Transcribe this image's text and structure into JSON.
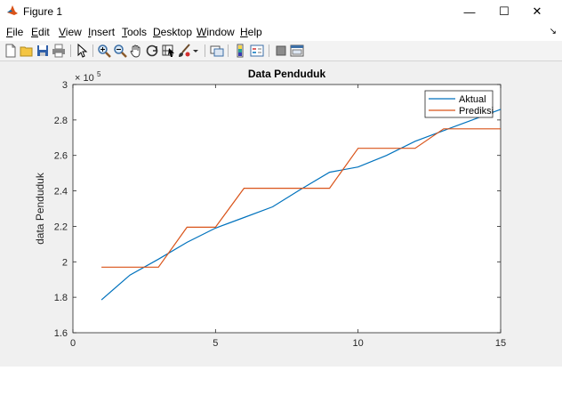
{
  "window": {
    "title": "Figure 1",
    "minimize_glyph": "—",
    "maximize_glyph": "☐",
    "close_glyph": "✕",
    "dock_glyph": "↘"
  },
  "menu": [
    {
      "label": "File",
      "u": "F",
      "rest": "ile"
    },
    {
      "label": "Edit",
      "u": "E",
      "rest": "dit"
    },
    {
      "label": "View",
      "u": "V",
      "rest": "iew"
    },
    {
      "label": "Insert",
      "u": "I",
      "rest": "nsert"
    },
    {
      "label": "Tools",
      "u": "T",
      "rest": "ools"
    },
    {
      "label": "Desktop",
      "u": "D",
      "rest": "esktop"
    },
    {
      "label": "Window",
      "u": "W",
      "rest": "indow"
    },
    {
      "label": "Help",
      "u": "H",
      "rest": "elp"
    }
  ],
  "toolbar": {
    "icons": [
      "new-figure-icon",
      "open-file-icon",
      "save-icon",
      "print-icon",
      "edit-plot-arrow-icon",
      "zoom-in-icon",
      "zoom-out-icon",
      "pan-hand-icon",
      "rotate-3d-icon",
      "data-cursor-icon",
      "brush-icon",
      "brush-dropdown-icon",
      "link-plot-icon",
      "colorbar-icon",
      "legend-icon",
      "hide-plot-tools-icon",
      "show-plot-tools-icon"
    ]
  },
  "chart_data": {
    "type": "line",
    "title": "Data Penduduk",
    "xlabel": "",
    "ylabel": "data Penduduk",
    "xlim": [
      0,
      15
    ],
    "ylim": [
      1.6,
      3.0
    ],
    "y_exponent_label": "× 10",
    "y_exponent_power": "5",
    "xticks": [
      "0",
      "5",
      "10",
      "15"
    ],
    "xtick_values": [
      0,
      5,
      10,
      15
    ],
    "yticks": [
      "1.6",
      "1.8",
      "2",
      "2.2",
      "2.4",
      "2.6",
      "2.8",
      "3"
    ],
    "ytick_values": [
      1.6,
      1.8,
      2.0,
      2.2,
      2.4,
      2.6,
      2.8,
      3.0
    ],
    "legend_position": "top-right",
    "grid": false,
    "series": [
      {
        "name": "Aktual",
        "color": "#0072bd",
        "x": [
          1,
          2,
          3,
          4,
          5,
          6,
          7,
          8,
          9,
          10,
          11,
          12,
          13,
          14,
          15
        ],
        "y": [
          1.785,
          1.925,
          2.015,
          2.11,
          2.19,
          2.25,
          2.31,
          2.41,
          2.505,
          2.535,
          2.6,
          2.68,
          2.74,
          2.8,
          2.86
        ]
      },
      {
        "name": "Prediksi",
        "color": "#d95319",
        "x": [
          1,
          2,
          3,
          3,
          4,
          5,
          5,
          6,
          7,
          8,
          9,
          9,
          10,
          11,
          12,
          12,
          13,
          14,
          15
        ],
        "y": [
          1.97,
          1.97,
          1.97,
          1.97,
          2.195,
          2.195,
          2.195,
          2.415,
          2.415,
          2.415,
          2.415,
          2.415,
          2.64,
          2.64,
          2.64,
          2.64,
          2.75,
          2.75,
          2.75
        ]
      }
    ]
  }
}
